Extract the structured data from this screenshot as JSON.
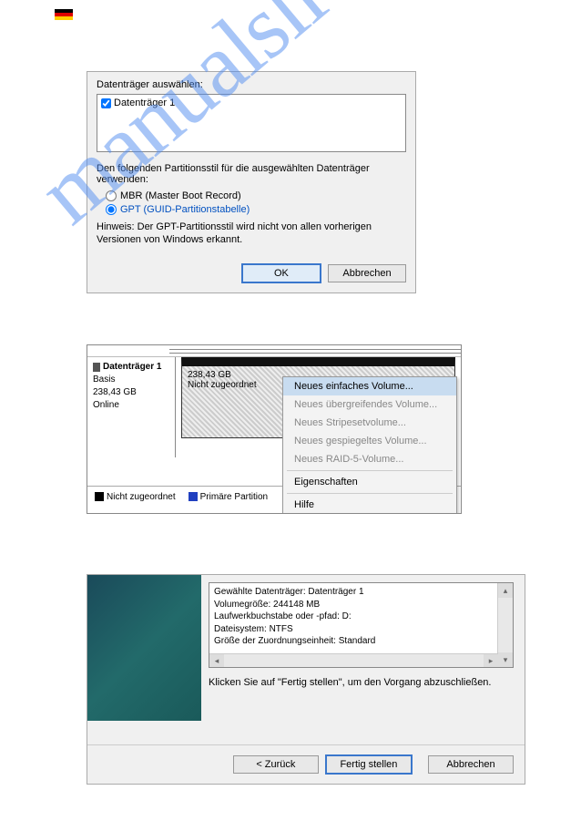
{
  "flag": {
    "top": "#000000",
    "mid": "#dd0000",
    "bot": "#ffce00"
  },
  "watermark": "manualslive.com",
  "dialog1": {
    "select_label": "Datenträger auswählen:",
    "disk_item": "Datenträger 1",
    "style_text": "Den folgenden Partitionsstil für die ausgewählten Datenträger verwenden:",
    "radio_mbr": "MBR (Master Boot Record)",
    "radio_gpt": "GPT (GUID-Partitionstabelle)",
    "note": "Hinweis: Der GPT-Partitionsstil wird nicht von allen vorherigen Versionen von Windows erkannt.",
    "ok": "OK",
    "cancel": "Abbrechen"
  },
  "panel2": {
    "disk_head": "Datenträger 1",
    "disk_type": "Basis",
    "disk_size": "238,43 GB",
    "disk_status": "Online",
    "region_size": "238,43 GB",
    "region_state": "Nicht zugeordnet",
    "menu": {
      "simple": "Neues einfaches Volume...",
      "spanned": "Neues übergreifendes Volume...",
      "striped": "Neues Stripesetvolume...",
      "mirrored": "Neues gespiegeltes Volume...",
      "raid5": "Neues RAID-5-Volume...",
      "props": "Eigenschaften",
      "help": "Hilfe"
    },
    "legend_unalloc": "Nicht zugeordnet",
    "legend_primary": "Primäre Partition"
  },
  "wizard3": {
    "lines": {
      "l1": "Gewählte Datenträger: Datenträger 1",
      "l2": "Volumegröße: 244148 MB",
      "l3": "Laufwerkbuchstabe oder -pfad: D:",
      "l4": "Dateisystem: NTFS",
      "l5": "Größe der Zuordnungseinheit: Standard"
    },
    "msg": "Klicken Sie auf \"Fertig stellen\", um den Vorgang abzuschließen.",
    "back": "< Zurück",
    "finish": "Fertig stellen",
    "cancel": "Abbrechen"
  }
}
